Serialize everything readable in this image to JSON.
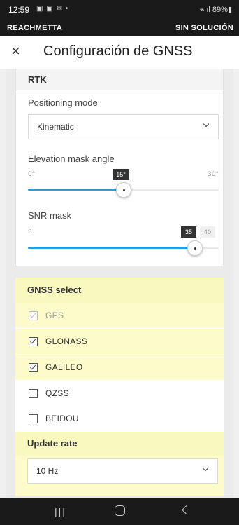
{
  "status_bar": {
    "time": "12:59",
    "left_icons": "▣ ▣ ✉ •",
    "right_text": "⌁ ıl 89%▮"
  },
  "banner": {
    "device": "REACHMETTA",
    "solution_status": "SIN SOLUCIÓN"
  },
  "app_bar": {
    "close_icon": "×",
    "title": "Configuración de GNSS"
  },
  "rtk": {
    "header": "RTK",
    "positioning_mode": {
      "label": "Positioning mode",
      "value": "Kinematic"
    },
    "elevation_mask": {
      "label": "Elevation mask angle",
      "min": "0°",
      "max": "30°",
      "value_label": "15°",
      "value": 15,
      "fraction": 0.5
    },
    "snr_mask": {
      "label": "SNR mask",
      "min": "0",
      "max": "40",
      "value_label": "35",
      "value": 35,
      "fraction": 0.875
    }
  },
  "gnss_select": {
    "header": "GNSS select",
    "items": [
      {
        "label": "GPS",
        "checked": true,
        "disabled": true
      },
      {
        "label": "GLONASS",
        "checked": true,
        "disabled": false
      },
      {
        "label": "GALILEO",
        "checked": true,
        "disabled": false
      },
      {
        "label": "QZSS",
        "checked": false,
        "disabled": false
      },
      {
        "label": "BEIDOU",
        "checked": false,
        "disabled": false
      }
    ]
  },
  "update_rate": {
    "header": "Update rate",
    "value": "10 Hz"
  },
  "nav_bar": {
    "recents_icon": "|||"
  },
  "colors": {
    "accent": "#2d9cdb",
    "highlight": "#fdfbc9",
    "dark": "#1a1a1a"
  }
}
